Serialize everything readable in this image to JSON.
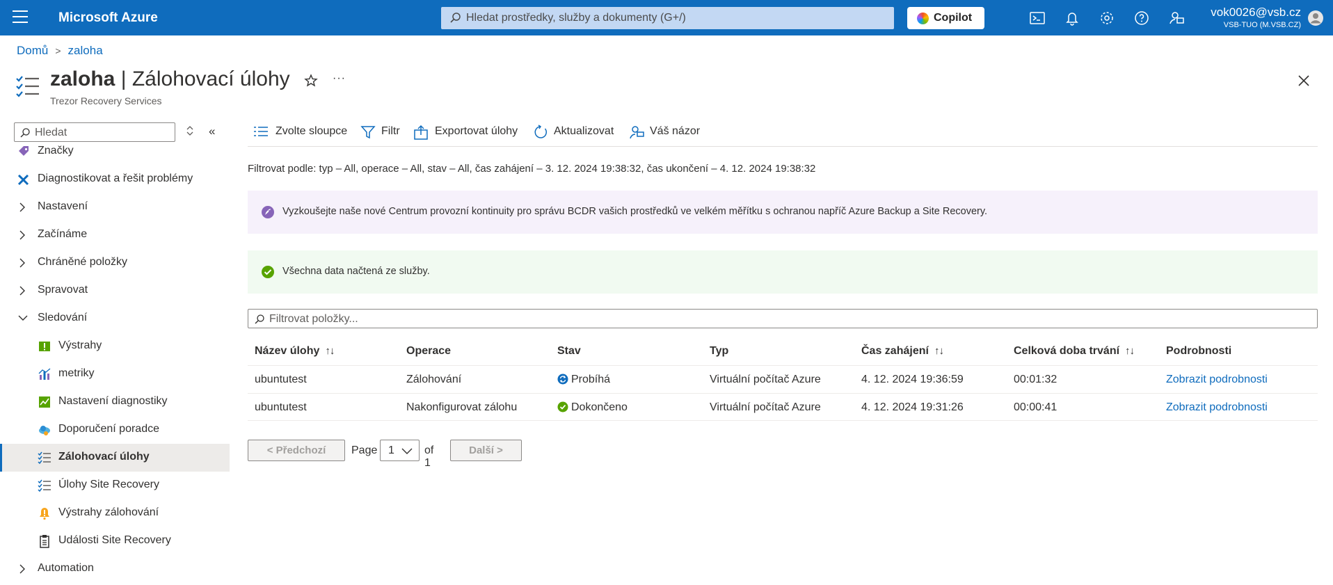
{
  "topbar": {
    "brand": "Microsoft Azure",
    "search_placeholder": "Hledat prostředky, služby a dokumenty (G+/)",
    "copilot_label": "Copilot",
    "icons": [
      "cloud-shell-icon",
      "bell-icon",
      "gear-icon",
      "help-icon",
      "feedback-icon"
    ],
    "account_email": "vok0026@vsb.cz",
    "account_tenant": "VSB-TUO (M.VSB.CZ)",
    "accent_color": "#0f6cbd"
  },
  "breadcrumb": {
    "home": "Domů",
    "current": "zaloha"
  },
  "header": {
    "title_resource": "zaloha",
    "title_separator": " | ",
    "title_page": "Zálohovací úlohy",
    "subtitle": "Trezor Recovery Services"
  },
  "sidebar": {
    "search_placeholder": "Hledat",
    "items": [
      {
        "label": "Značky",
        "icon": "tag-icon",
        "type": "leaf"
      },
      {
        "label": "Diagnostikovat a řešit problémy",
        "icon": "wrench-icon",
        "type": "leaf"
      },
      {
        "label": "Nastavení",
        "type": "group",
        "expanded": false
      },
      {
        "label": "Začínáme",
        "type": "group",
        "expanded": false
      },
      {
        "label": "Chráněné položky",
        "type": "group",
        "expanded": false
      },
      {
        "label": "Spravovat",
        "type": "group",
        "expanded": false
      },
      {
        "label": "Sledování",
        "type": "group",
        "expanded": true
      },
      {
        "label": "Výstrahy",
        "icon": "alert-icon",
        "type": "child"
      },
      {
        "label": "metriky",
        "icon": "metrics-icon",
        "type": "child"
      },
      {
        "label": "Nastavení diagnostiky",
        "icon": "diagnostics-icon",
        "type": "child"
      },
      {
        "label": "Doporučení poradce",
        "icon": "advisor-icon",
        "type": "child"
      },
      {
        "label": "Zálohovací úlohy",
        "icon": "jobs-icon",
        "type": "child",
        "active": true
      },
      {
        "label": "Úlohy Site Recovery",
        "icon": "jobs-icon",
        "type": "child"
      },
      {
        "label": "Výstrahy zálohování",
        "icon": "warning-icon",
        "type": "child"
      },
      {
        "label": "Události Site Recovery",
        "icon": "clipboard-icon",
        "type": "child"
      },
      {
        "label": "Automation",
        "type": "group",
        "expanded": false
      }
    ]
  },
  "toolbar": {
    "columns": "Zvolte sloupce",
    "filter": "Filtr",
    "export": "Exportovat úlohy",
    "refresh": "Aktualizovat",
    "feedback": "Váš názor"
  },
  "filter_summary": "Filtrovat podle: typ – All, operace – All, stav – All, čas zahájení – 3. 12. 2024 19:38:32, čas ukončení – 4. 12. 2024 19:38:32",
  "banners": {
    "promo": "Vyzkoušejte naše nové Centrum provozní kontinuity pro správu BCDR vašich prostředků ve velkém měřítku s ochranou napříč Azure Backup a Site Recovery.",
    "success": "Všechna data načtená ze služby."
  },
  "filter_items_placeholder": "Filtrovat položky...",
  "table": {
    "headers": [
      "Název úlohy",
      "Operace",
      "Stav",
      "Typ",
      "Čas zahájení",
      "Celková doba trvání",
      "Podrobnosti"
    ],
    "sort_glyph": "↑↓",
    "rows": [
      {
        "name": "ubuntutest",
        "operation": "Zálohování",
        "status": "Probíhá",
        "status_icon": "in-progress-icon",
        "type": "Virtuální počítač Azure",
        "start": "4. 12. 2024 19:36:59",
        "duration": "00:01:32",
        "details": "Zobrazit podrobnosti"
      },
      {
        "name": "ubuntutest",
        "operation": "Nakonfigurovat zálohu",
        "status": "Dokončeno",
        "status_icon": "success-icon",
        "type": "Virtuální počítač Azure",
        "start": "4. 12. 2024 19:31:26",
        "duration": "00:00:41",
        "details": "Zobrazit podrobnosti"
      }
    ]
  },
  "pager": {
    "prev": "< Předchozí",
    "page_label": "Page",
    "page_value": "1",
    "of_label": "of 1",
    "next": "Další >"
  }
}
